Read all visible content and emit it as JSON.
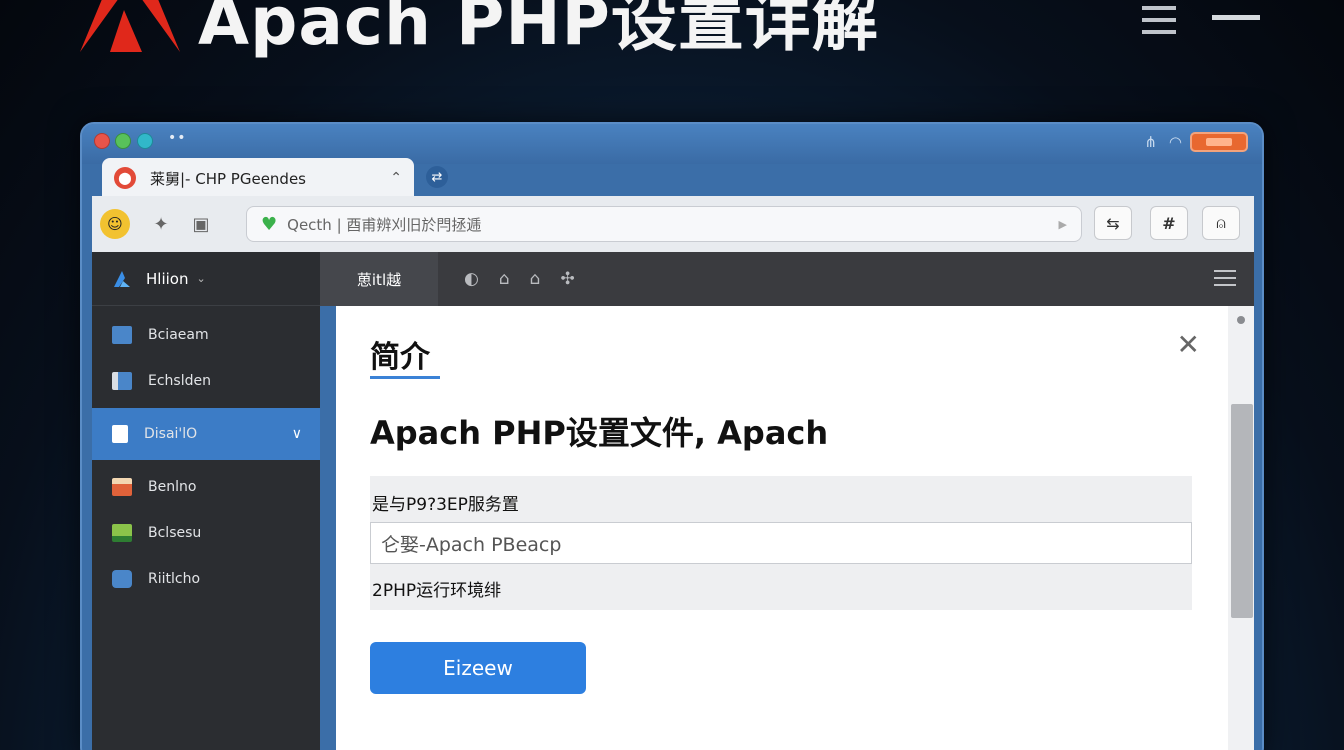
{
  "header": {
    "title": "Apach PHP设置详解",
    "logo_icon": "adobe-style-logo-icon",
    "brand_color": "#e0281b"
  },
  "window": {
    "tab": {
      "label": "莱舅|- CHP PGeendes",
      "favicon_icon": "app-favicon-icon",
      "pin_icon": "pin-icon"
    },
    "address_bar": {
      "url": "Qecth | 酉甫辨刈旧於閂拯逓"
    },
    "sidebar": {
      "header_label": "Hliion",
      "items": [
        {
          "label": "Bciaeam",
          "icon_color": "#4a86c9"
        },
        {
          "label": "Echslden",
          "icon_color": "#4a86c9"
        },
        {
          "label": "Disai'lO",
          "icon_color": "#ffffff",
          "active": true
        },
        {
          "label": "Benlno",
          "icon_color": "#e0623a"
        },
        {
          "label": "Bclsesu",
          "icon_color": "#8bc34a"
        },
        {
          "label": "Riitlcho",
          "icon_color": "#4a86c9"
        }
      ]
    },
    "content_bar": {
      "title": "葸itl越"
    },
    "dialog": {
      "heading": "简介",
      "subtitle": "Apach PHP设置文件, Apach",
      "field_label": "是与P9?3EP服务置",
      "field_value": "仑娶-Apach PBeacp",
      "field_note": "2PHP运行环境绯",
      "button_label": "Eizeew",
      "close_icon": "close-icon"
    },
    "accent_color": "#2d7fe0"
  }
}
